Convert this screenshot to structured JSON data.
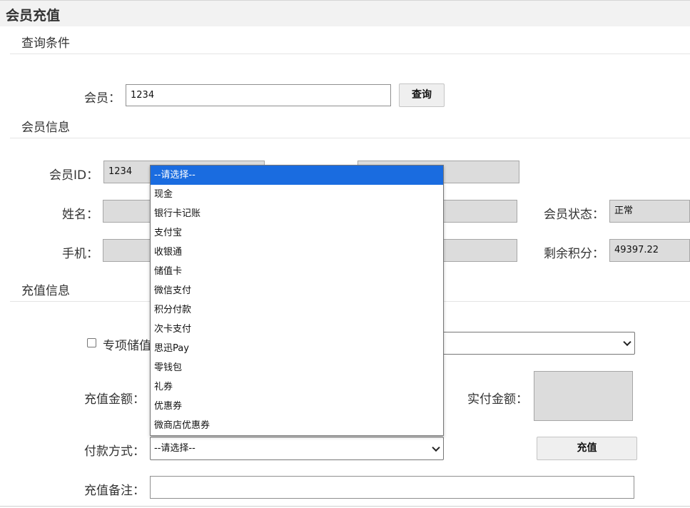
{
  "page": {
    "title": "会员充值"
  },
  "query": {
    "section_title": "查询条件",
    "member_label": "会员：",
    "member_value": "1234",
    "query_button": "查询"
  },
  "member_info": {
    "section_title": "会员信息",
    "id_label": "会员ID：",
    "id_value": "1234",
    "name_label": "姓名：",
    "name_value": "",
    "phone_label": "手机：",
    "phone_value": "",
    "status_label": "会员状态：",
    "status_value": "正常",
    "points_label": "剩余积分：",
    "points_value": "49397.22"
  },
  "recharge": {
    "section_title": "充值信息",
    "special_label": "专项储值",
    "special_checked": false,
    "amount_label": "充值金额：",
    "actual_label": "实付金额：",
    "payment_label": "付款方式：",
    "payment_selected": "--请选择--",
    "recharge_button": "充值",
    "remark_label": "充值备注："
  },
  "payment_dropdown": {
    "options": [
      "--请选择--",
      "现金",
      "银行卡记账",
      "支付宝",
      "收银通",
      "储值卡",
      "微信支付",
      "积分付款",
      "次卡支付",
      "思迅Pay",
      "零钱包",
      "礼券",
      "优惠券",
      "微商店优惠券"
    ],
    "highlighted_index": 0
  },
  "colors": {
    "header_bg": "#f2f2f2",
    "readonly_bg": "#dcdcdc",
    "highlight": "#1a6ce0"
  }
}
